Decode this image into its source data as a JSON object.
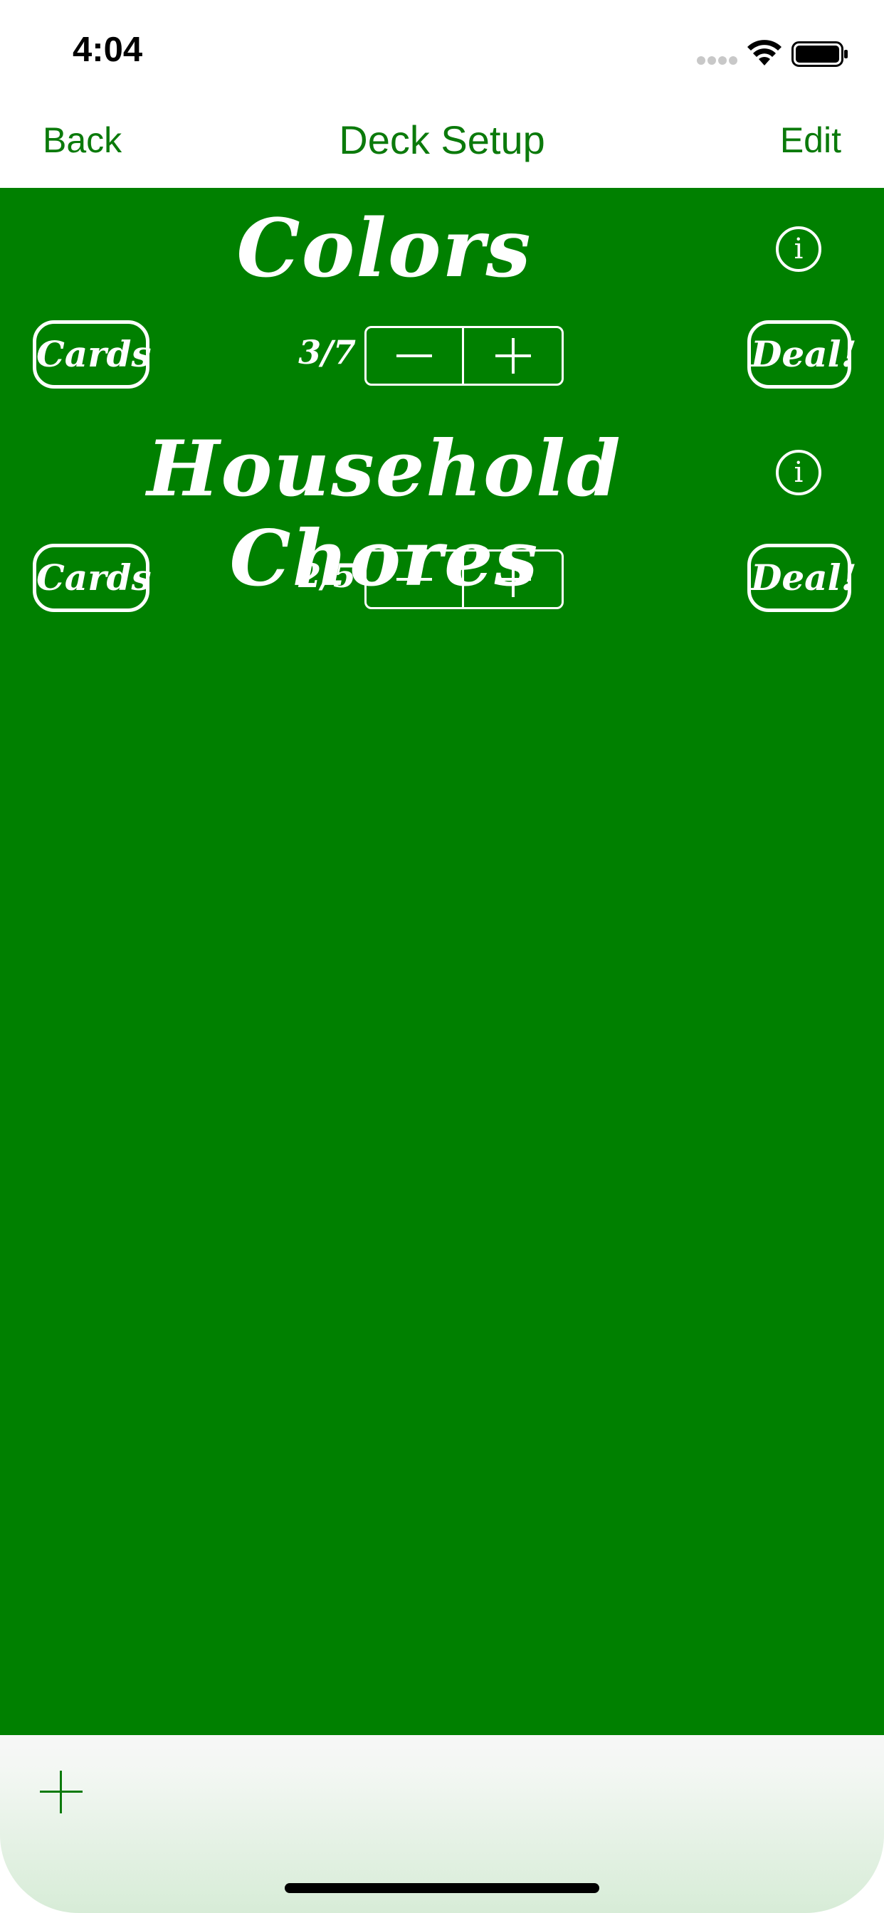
{
  "status_bar": {
    "time": "4:04",
    "icons": [
      "signal-icon",
      "wifi-icon",
      "battery-icon"
    ]
  },
  "nav": {
    "back_label": "Back",
    "title": "Deck Setup",
    "edit_label": "Edit"
  },
  "decks": [
    {
      "name": "Colors",
      "info_symbol": "i",
      "cards_label": "Cards",
      "count": "3/7",
      "deal_label": "Deal!"
    },
    {
      "name": "Household Chores",
      "info_symbol": "i",
      "cards_label": "Cards",
      "count": "2/5",
      "deal_label": "Deal!"
    }
  ],
  "toolbar": {
    "add_icon": "plus-icon"
  },
  "colors": {
    "accent": "#0b7a0b",
    "table_green": "#008000",
    "white": "#ffffff"
  }
}
